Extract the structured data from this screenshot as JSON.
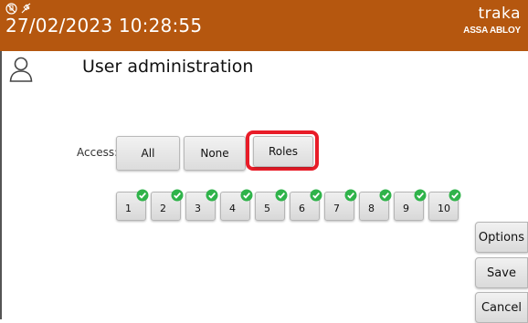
{
  "header": {
    "datetime": "27/02/2023 10:28:55",
    "logo_main": "traka",
    "logo_sub": "ASSA ABLOY",
    "status_icons": [
      "network-icon",
      "power-icon"
    ],
    "bar_color": "#b5570f"
  },
  "page": {
    "title": "User administration",
    "user_icon": "user-icon"
  },
  "access": {
    "label": "Access:",
    "buttons": [
      "All",
      "None",
      "Roles"
    ],
    "highlighted": "Roles",
    "highlight_color": "#e81c28"
  },
  "slots": {
    "items": [
      "1",
      "2",
      "3",
      "4",
      "5",
      "6",
      "7",
      "8",
      "9",
      "10"
    ],
    "checked_color": "#2fb34a"
  },
  "side_buttons": {
    "options": "Options",
    "save": "Save",
    "cancel": "Cancel"
  }
}
